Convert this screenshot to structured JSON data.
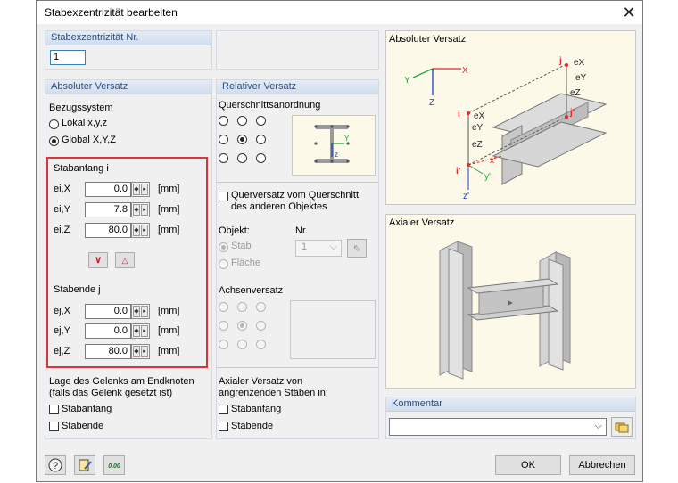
{
  "title": "Stabexzentrizität bearbeiten",
  "close_glyph": "✕",
  "panel_nr": {
    "header": "Stabexzentrizität Nr.",
    "value": "1"
  },
  "absolute": {
    "header": "Absoluter Versatz",
    "bezugssystem_label": "Bezugssystem",
    "radio_lokal": "Lokal x,y,z",
    "radio_global": "Global X,Y,Z",
    "selected": "Global X,Y,Z",
    "stabanfang": {
      "title": "Stabanfang i",
      "rows": [
        {
          "label": "ei,X",
          "value": "0.0",
          "unit": "[mm]"
        },
        {
          "label": "ei,Y",
          "value": "7.8",
          "unit": "[mm]"
        },
        {
          "label": "ei,Z",
          "value": "80.0",
          "unit": "[mm]"
        }
      ]
    },
    "stabende": {
      "title": "Stabende j",
      "rows": [
        {
          "label": "ej,X",
          "value": "0.0",
          "unit": "[mm]"
        },
        {
          "label": "ej,Y",
          "value": "0.0",
          "unit": "[mm]"
        },
        {
          "label": "ej,Z",
          "value": "80.0",
          "unit": "[mm]"
        }
      ]
    },
    "highlight_color": "#d9343a",
    "gelenk_label_1": "Lage des Gelenks am Endknoten",
    "gelenk_label_2": "(falls das Gelenk gesetzt ist)",
    "chk_stabanfang": "Stabanfang",
    "chk_stabende": "Stabende"
  },
  "relative": {
    "header": "Relativer Versatz",
    "querschnitt_label": "Querschnittsanordnung",
    "quer_chk_1": "Querversatz vom Querschnitt",
    "quer_chk_2": "des anderen Objektes",
    "objekt_label": "Objekt:",
    "nr_label": "Nr.",
    "radio_stab": "Stab",
    "radio_flaeche": "Fläche",
    "nr_value": "1",
    "achsen_label": "Achsenversatz",
    "axial_label_1": "Axialer Versatz von",
    "axial_label_2": "angrenzenden Stäben in:",
    "chk_stabanfang": "Stabanfang",
    "chk_stabende": "Stabende"
  },
  "preview_abs": {
    "header": "Absoluter Versatz",
    "labels": {
      "j": "j",
      "ex": "eX",
      "ey": "eY",
      "ez": "eZ",
      "jp": "j'",
      "i": "i",
      "ip": "i'",
      "x": "X",
      "y": "Y",
      "z": "Z",
      "xp": "x'",
      "yp": "y'",
      "zp": "z'"
    }
  },
  "preview_axial": {
    "header": "Axialer Versatz"
  },
  "kommentar": {
    "header": "Kommentar",
    "value": ""
  },
  "footer": {
    "ok": "OK",
    "cancel": "Abbrechen",
    "calc_icon_text": "0.00"
  },
  "colors": {
    "red": "#e8262b",
    "green": "#22a33a",
    "blue": "#1a3fd1",
    "header_text": "#2e4c80"
  }
}
